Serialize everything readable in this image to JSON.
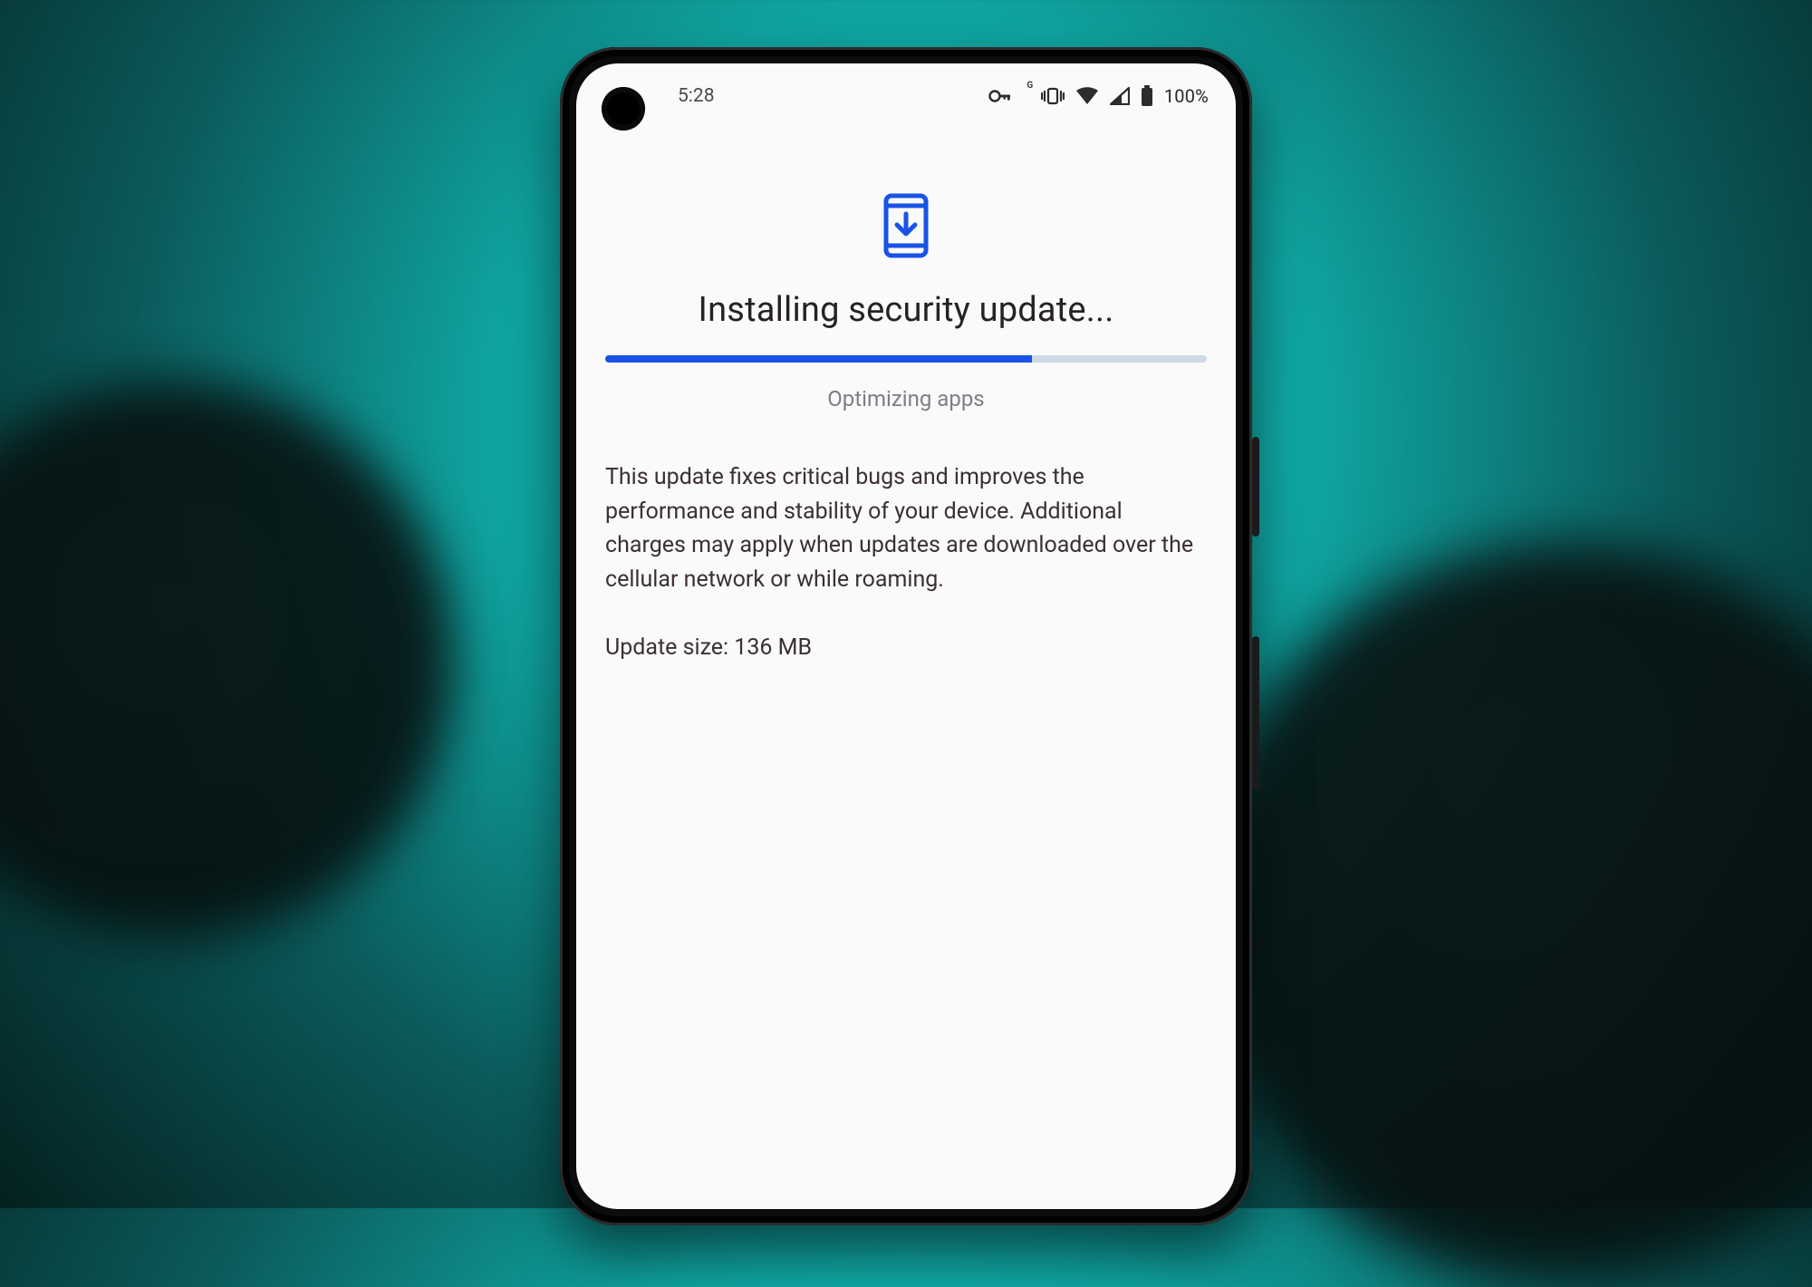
{
  "statusbar": {
    "time": "5:28",
    "battery_pct": "100%"
  },
  "update": {
    "title": "Installing security update...",
    "progress_pct": 71,
    "stage_text": "Optimizing apps",
    "description": "This update fixes critical bugs and improves the performance and stability of your device. Additional charges may apply when updates are downloaded over the cellular network or while roaming.",
    "size_line": "Update size: 136 MB"
  },
  "colors": {
    "accent": "#1953e6",
    "progress_track": "#cfd8e6"
  }
}
